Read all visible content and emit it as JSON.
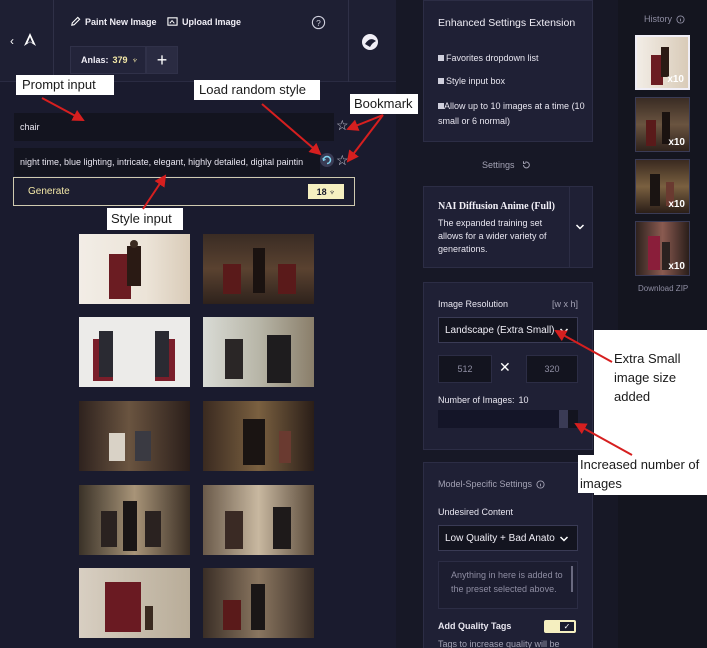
{
  "topbar": {
    "paint_label": "Paint New Image",
    "upload_label": "Upload Image",
    "anlas_label": "Anlas:",
    "anlas_value": "379",
    "plus": "+"
  },
  "prompt": {
    "value": "chair"
  },
  "style": {
    "value": "night time, blue lighting, intricate, elegant, highly detailed, digital paintin"
  },
  "generate": {
    "label": "Generate",
    "cost": "18"
  },
  "extension": {
    "title": "Enhanced Settings Extension",
    "opt1": "Favorites dropdown list",
    "opt2": "Style input box",
    "opt3": "Allow up to 10 images at a time (10 small or 6 normal)"
  },
  "settings_label": "Settings",
  "model": {
    "name": "NAI Diffusion Anime (Full)",
    "desc": "The expanded training set allows for a wider variety of generations."
  },
  "resolution": {
    "label": "Image Resolution",
    "hint": "[w x h]",
    "selected": "Landscape (Extra Small)",
    "width": "512",
    "height": "320",
    "times": "✕"
  },
  "num_images": {
    "label": "Number of Images:",
    "value": "10",
    "fraction": 0.92
  },
  "model_settings": {
    "title": "Model-Specific Settings",
    "undesired_label": "Undesired Content",
    "undesired_selected": "Low Quality + Bad Anato",
    "undesired_text": "Anything in here is added to the preset selected above.",
    "quality_label": "Add Quality Tags",
    "quality_hint": "Tags to increase quality will be"
  },
  "history": {
    "label": "History",
    "count": "x10",
    "download": "Download ZIP"
  },
  "annotations": {
    "prompt_input": "Prompt  input",
    "random_style": "Load random style",
    "bookmark": "Bookmark",
    "style_input": "Style input",
    "extra_small": "Extra Small image size added",
    "increased": "Increased number of images"
  }
}
